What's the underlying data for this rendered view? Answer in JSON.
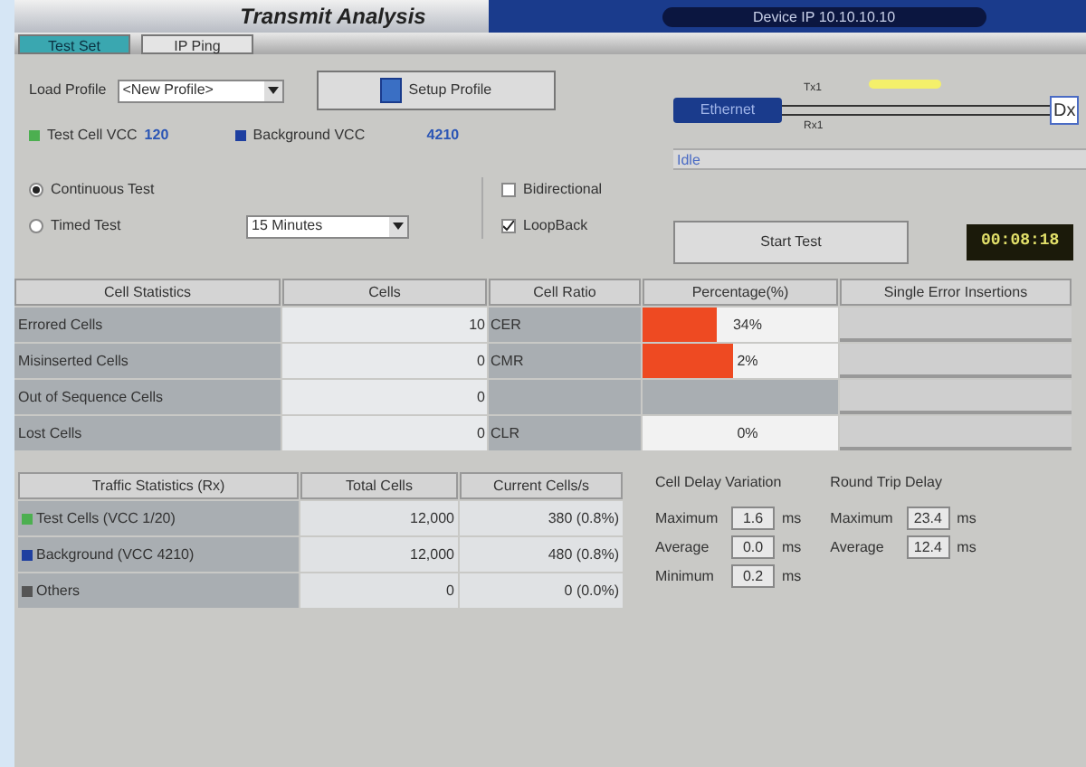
{
  "window": {
    "title": "Transmit Analysis",
    "device": "Device IP 10.10.10.10"
  },
  "tabs": [
    {
      "label": "Test Set",
      "selected": true
    },
    {
      "label": "IP Ping",
      "selected": false
    }
  ],
  "profile": {
    "label": "Load Profile",
    "value": "<New Profile>",
    "button": "Setup Profile"
  },
  "vccs": [
    {
      "label": "Test Cell VCC",
      "value": "120",
      "color": "#4caf50"
    },
    {
      "label": "Background VCC",
      "value": "4210",
      "color": "#1e3fa0"
    }
  ],
  "diagram": {
    "source": "Ethernet",
    "tx": "Tx1",
    "rx": "Rx1",
    "target": "Dx",
    "status": "Idle"
  },
  "modes": [
    {
      "label": "Continuous Test",
      "selected": true
    },
    {
      "label": "Timed Test",
      "selected": false
    }
  ],
  "duration": "15 Minutes",
  "options": [
    {
      "label": "Bidirectional",
      "checked": false
    },
    {
      "label": "LoopBack",
      "checked": true
    }
  ],
  "start_button": "Start Test",
  "timer": "00:08:18",
  "cell_table": {
    "columns": [
      "Cell Statistics",
      "Cells",
      "Cell Ratio",
      "Percentage(%)",
      "Single Error Insertions"
    ],
    "rows": [
      {
        "name": "Errored Cells",
        "cells": "10",
        "ratio": "CER",
        "percent": "34%",
        "level": 0.38
      },
      {
        "name": "Misinserted Cells",
        "cells": "0",
        "ratio": "CMR",
        "percent": "2%",
        "level": 0.46
      },
      {
        "name": "Out of Sequence Cells",
        "cells": "0"
      },
      {
        "name": "Lost Cells",
        "cells": "0",
        "ratio": "CLR",
        "percent": "0%"
      }
    ]
  },
  "traffic_table": {
    "columns": [
      "Traffic Statistics (Rx)",
      "Total Cells",
      "Current Cells/s"
    ],
    "rows": [
      {
        "name": "Test Cells (VCC 1/20)",
        "color": "#4caf50",
        "total": "12,000",
        "current": "380 (0.8%)"
      },
      {
        "name": "Background (VCC 4210)",
        "color": "#1e3fa0",
        "total": "12,000",
        "current": "480 (0.8%)"
      },
      {
        "name": "Others",
        "color": "#555555",
        "total": "0",
        "current": "0 (0.0%)"
      }
    ]
  },
  "cell_delay": {
    "title": "Cell Delay Variation",
    "rows": [
      {
        "label": "Maximum",
        "value": "1.6",
        "unit": "ms"
      },
      {
        "label": "Average",
        "value": "0.0",
        "unit": "ms"
      },
      {
        "label": "Minimum",
        "value": "0.2",
        "unit": "ms"
      }
    ]
  },
  "round_trip": {
    "title": "Round Trip Delay",
    "rows": [
      {
        "label": "Maximum",
        "value": "23.4",
        "unit": "ms"
      },
      {
        "label": "Average",
        "value": "12.4",
        "unit": "ms"
      }
    ]
  }
}
